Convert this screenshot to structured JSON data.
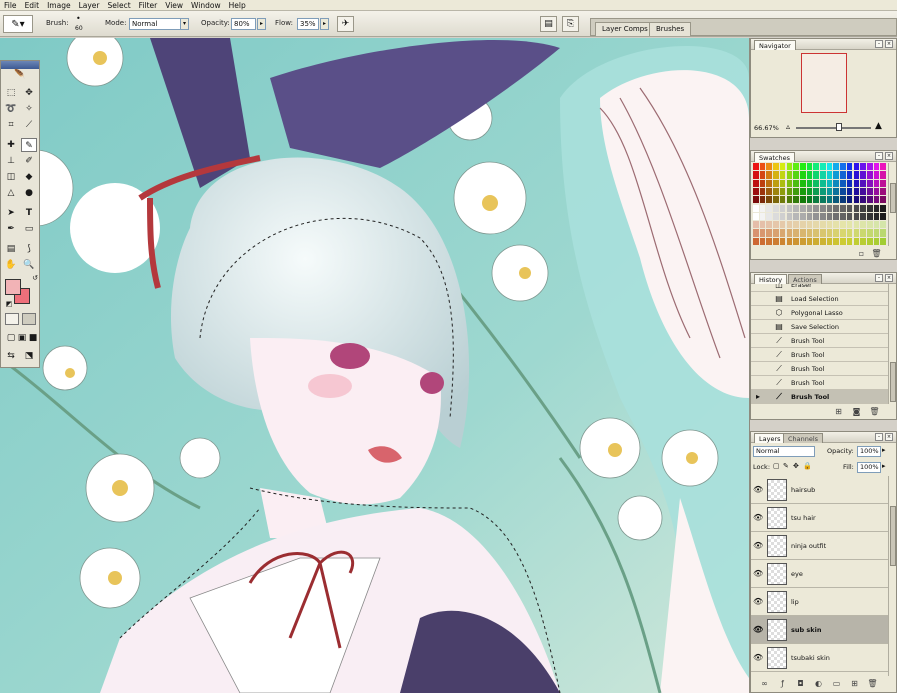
{
  "menu": [
    "File",
    "Edit",
    "Image",
    "Layer",
    "Select",
    "Filter",
    "View",
    "Window",
    "Help"
  ],
  "options": {
    "brush_label": "Brush:",
    "brush_size": "60",
    "mode_label": "Mode:",
    "mode_value": "Normal",
    "opacity_label": "Opacity:",
    "opacity_value": "80%",
    "flow_label": "Flow:",
    "flow_value": "35%",
    "dock_tabs": [
      "Layer Comps",
      "Brushes"
    ]
  },
  "navigator": {
    "tab": "Navigator",
    "zoom": "66.67%"
  },
  "swatches": {
    "tab": "Swatches"
  },
  "history": {
    "tabs": [
      "History",
      "Actions"
    ],
    "items": [
      {
        "label": "Eraser",
        "icon": "eraser-icon"
      },
      {
        "label": "Load Selection",
        "icon": "selection-icon"
      },
      {
        "label": "Polygonal Lasso",
        "icon": "polygonal-lasso-icon"
      },
      {
        "label": "Save Selection",
        "icon": "selection-icon"
      },
      {
        "label": "Brush Tool",
        "icon": "brush-icon"
      },
      {
        "label": "Brush Tool",
        "icon": "brush-icon"
      },
      {
        "label": "Brush Tool",
        "icon": "brush-icon"
      },
      {
        "label": "Brush Tool",
        "icon": "brush-icon"
      },
      {
        "label": "Brush Tool",
        "icon": "brush-icon",
        "current": true
      }
    ]
  },
  "layers": {
    "tabs": [
      "Layers",
      "Channels"
    ],
    "blend_mode": "Normal",
    "opacity_label": "Opacity:",
    "opacity_value": "100%",
    "lock_label": "Lock:",
    "fill_label": "Fill:",
    "fill_value": "100%",
    "items": [
      {
        "name": "hairsub"
      },
      {
        "name": "tsu hair"
      },
      {
        "name": "ninja outfit"
      },
      {
        "name": "eye"
      },
      {
        "name": "lip"
      },
      {
        "name": "sub skin",
        "selected": true
      },
      {
        "name": "tsubaki skin"
      }
    ]
  },
  "colors": {
    "foreground": "#f2b3b6",
    "background": "#ee6f7a",
    "canvas_bg": "#8fd0c9"
  }
}
